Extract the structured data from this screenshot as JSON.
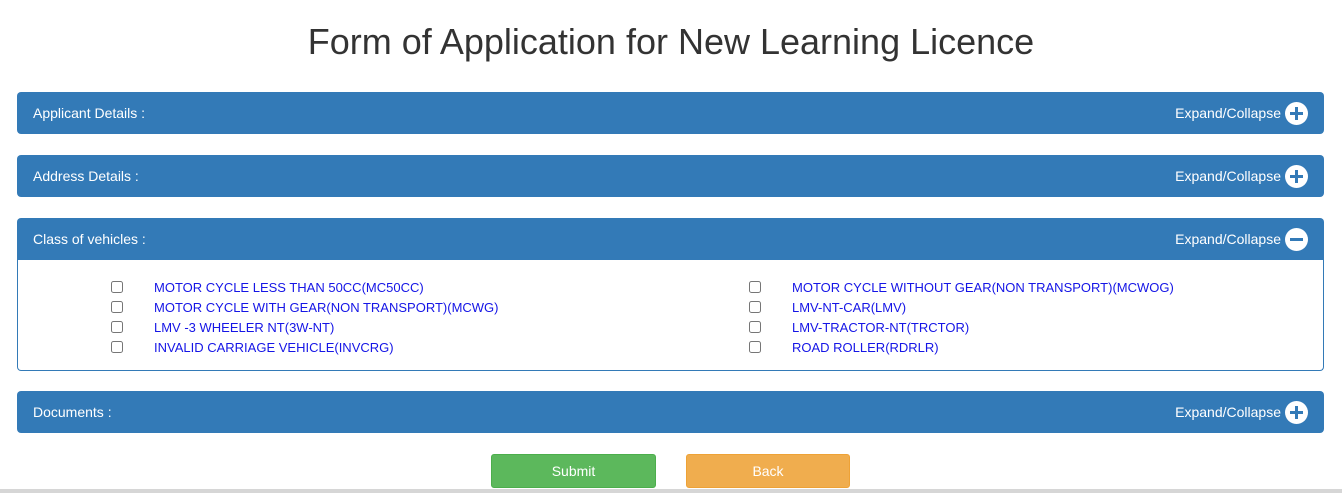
{
  "page": {
    "title": "Form of Application for New Learning Licence"
  },
  "panels": {
    "applicant": {
      "title": "Applicant Details :",
      "toggle_label": "Expand/Collapse",
      "state_icon": "plus-circle-icon"
    },
    "address": {
      "title": "Address Details :",
      "toggle_label": "Expand/Collapse",
      "state_icon": "plus-circle-icon"
    },
    "vehicles": {
      "title": "Class of vehicles :",
      "toggle_label": "Expand/Collapse",
      "state_icon": "minus-circle-icon",
      "left": [
        {
          "label": "MOTOR CYCLE LESS THAN 50CC(MC50CC)",
          "checked": false
        },
        {
          "label": "MOTOR CYCLE WITH GEAR(NON TRANSPORT)(MCWG)",
          "checked": false
        },
        {
          "label": "LMV -3 WHEELER NT(3W-NT)",
          "checked": false
        },
        {
          "label": "INVALID CARRIAGE VEHICLE(INVCRG)",
          "checked": false
        }
      ],
      "right": [
        {
          "label": "MOTOR CYCLE WITHOUT GEAR(NON TRANSPORT)(MCWOG)",
          "checked": false
        },
        {
          "label": "LMV-NT-CAR(LMV)",
          "checked": false
        },
        {
          "label": "LMV-TRACTOR-NT(TRCTOR)",
          "checked": false
        },
        {
          "label": "ROAD ROLLER(RDRLR)",
          "checked": false
        }
      ]
    },
    "documents": {
      "title": "Documents :",
      "toggle_label": "Expand/Collapse",
      "state_icon": "plus-circle-icon"
    }
  },
  "buttons": {
    "submit": "Submit",
    "back": "Back"
  },
  "colors": {
    "panel_header": "#337ab7",
    "link_text": "#1515e6",
    "submit": "#5cb85c",
    "back": "#f0ad4e"
  }
}
